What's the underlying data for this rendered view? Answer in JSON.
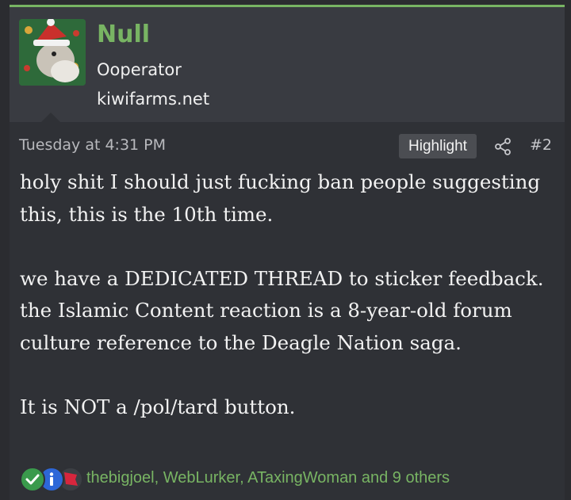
{
  "user": {
    "name": "Null",
    "title": "Ooperator",
    "site": "kiwifarms.net"
  },
  "post": {
    "date": "Tuesday at 4:31 PM",
    "highlight_label": "Highlight",
    "number": "#2",
    "paragraphs": [
      "holy shit I should just fucking ban people suggesting this, this is the 10th time.",
      "we have a DEDICATED THREAD to sticker feedback.\nthe Islamic Content reaction is a 8-year-old forum culture reference to the Deagle Nation saga.",
      "It is NOT a /pol/tard button."
    ]
  },
  "reactions": {
    "icons": [
      "check-reaction-icon",
      "info-reaction-icon",
      "flag-reaction-icon"
    ],
    "summary": "thebigjoel, WebLurker, ATaxingWoman and 9 others"
  },
  "colors": {
    "accent": "#78b463",
    "background": "#2b2c30",
    "header_bg": "#393b41",
    "post_bg": "#2f3136"
  }
}
